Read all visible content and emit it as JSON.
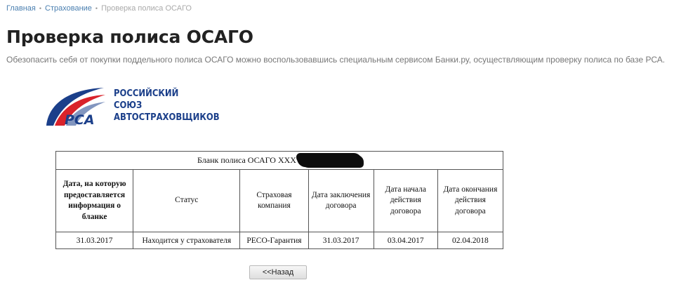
{
  "breadcrumb": {
    "items": [
      "Главная",
      "Страхование"
    ],
    "current": "Проверка полиса ОСАГО",
    "separator": "•"
  },
  "page": {
    "title": "Проверка полиса ОСАГО",
    "subtitle": "Обезопасить себя от покупки поддельного полиса ОСАГО можно воспользовавшись специальным сервисом Банки.ру, осуществляющим проверку полиса по базе РСА."
  },
  "logo": {
    "abbrev": "РСА",
    "lines": [
      "РОССИЙСКИЙ",
      "СОЮЗ",
      "АВТОСТРАХОВЩИКОВ"
    ],
    "colors": {
      "blue": "#1b3f8a",
      "red": "#d9222a"
    }
  },
  "policy_table": {
    "title_prefix": "Бланк полиса ОСАГО ХХХ",
    "headers": [
      "Дата, на которую предоставляется информация о бланке",
      "Статус",
      "Страховая компания",
      "Дата заключения договора",
      "Дата начала действия договора",
      "Дата окончания действия договора"
    ],
    "row": [
      "31.03.2017",
      "Находится у страхователя",
      "РЕСО-Гарантия",
      "31.03.2017",
      "03.04.2017",
      "02.04.2018"
    ]
  },
  "back_button": {
    "label": "<<Назад"
  }
}
